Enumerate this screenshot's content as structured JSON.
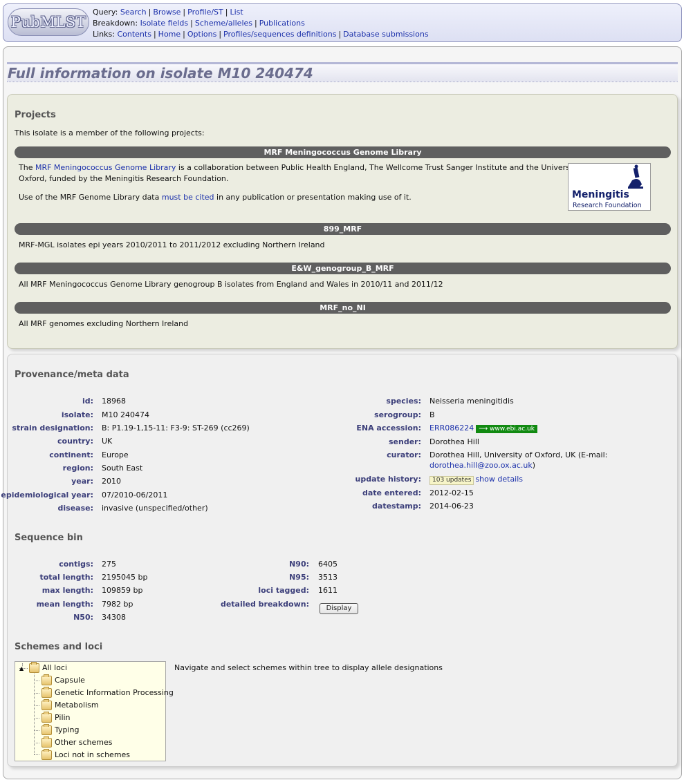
{
  "header": {
    "logo_text": "PubMLST",
    "query_label": "Query:",
    "query_links": [
      "Search",
      "Browse",
      "Profile/ST",
      "List"
    ],
    "breakdown_label": "Breakdown:",
    "breakdown_links": [
      "Isolate fields",
      "Scheme/alleles",
      "Publications"
    ],
    "links_label": "Links:",
    "links": [
      "Contents",
      "Home",
      "Options",
      "Profiles/sequences definitions",
      "Database submissions"
    ]
  },
  "page_title": "Full information on isolate M10 240474",
  "projects": {
    "heading": "Projects",
    "intro": "This isolate is a member of the following projects:",
    "items": [
      {
        "title": "MRF Meningococcus Genome Library",
        "desc_pre": "The ",
        "desc_link": "MRF Meningococcus Genome Library",
        "desc_line1_post": " is a collaboration between Public Health England, The Wellcome Trust Sanger Institute and the University of",
        "desc_line2": "Oxford, funded by the Meningitis Research Foundation.",
        "cite_pre": "Use of the MRF Genome Library data ",
        "cite_link": "must be cited",
        "cite_post": " in any publication or presentation making use of it.",
        "logo_line1": "Meningitis",
        "logo_line2": "Research Foundation"
      },
      {
        "title": "899_MRF",
        "desc": "MRF-MGL isolates epi years 2010/2011 to 2011/2012 excluding Northern Ireland"
      },
      {
        "title": "E&W_genogroup_B_MRF",
        "desc": "All MRF Meningococcus Genome Library genogroup B isolates from England and Wales in 2010/11 and 2011/12"
      },
      {
        "title": "MRF_no_NI",
        "desc": "All MRF genomes excluding Northern Ireland"
      }
    ]
  },
  "provenance": {
    "heading": "Provenance/meta data",
    "left": [
      {
        "label": "id:",
        "value": "18968"
      },
      {
        "label": "isolate:",
        "value": "M10 240474"
      },
      {
        "label": "strain designation:",
        "value": "B: P1.19-1,15-11: F3-9: ST-269 (cc269)"
      },
      {
        "label": "country:",
        "value": "UK"
      },
      {
        "label": "continent:",
        "value": "Europe"
      },
      {
        "label": "region:",
        "value": "South East"
      },
      {
        "label": "year:",
        "value": "2010"
      },
      {
        "label": "epidemiological year:",
        "value": "07/2010-06/2011"
      },
      {
        "label": "disease:",
        "value": "invasive (unspecified/other)"
      }
    ],
    "right": {
      "species_label": "species:",
      "species": "Neisseria meningitidis",
      "serogroup_label": "serogroup:",
      "serogroup": "B",
      "ena_label": "ENA accession:",
      "ena": "ERR086224",
      "ena_badge": "⟶ www.ebi.ac.uk",
      "sender_label": "sender:",
      "sender": "Dorothea Hill",
      "curator_label": "curator:",
      "curator_line1": "Dorothea Hill, University of Oxford, UK (E-mail:",
      "curator_email": "dorothea.hill@zoo.ox.ac.uk",
      "curator_close": ")",
      "update_label": "update history:",
      "update_badge": "103 updates",
      "update_link": "show details",
      "date_entered_label": "date entered:",
      "date_entered": "2012-02-15",
      "datestamp_label": "datestamp:",
      "datestamp": "2014-06-23"
    }
  },
  "seqbin": {
    "heading": "Sequence bin",
    "left": [
      {
        "label": "contigs:",
        "value": "275"
      },
      {
        "label": "total length:",
        "value": "2195045 bp"
      },
      {
        "label": "max length:",
        "value": "109859 bp"
      },
      {
        "label": "mean length:",
        "value": "7982 bp"
      },
      {
        "label": "N50:",
        "value": "34308"
      }
    ],
    "right": [
      {
        "label": "N90:",
        "value": "6405"
      },
      {
        "label": "N95:",
        "value": "3513"
      },
      {
        "label": "loci tagged:",
        "value": "1611"
      },
      {
        "label": "detailed breakdown:",
        "value": ""
      }
    ],
    "display_button": "Display"
  },
  "schemes": {
    "heading": "Schemes and loci",
    "root": "All loci",
    "nodes": [
      "Capsule",
      "Genetic Information Processing",
      "Metabolism",
      "Pilin",
      "Typing",
      "Other schemes",
      "Loci not in schemes"
    ],
    "nav_text": "Navigate and select schemes within tree to display allele designations"
  }
}
